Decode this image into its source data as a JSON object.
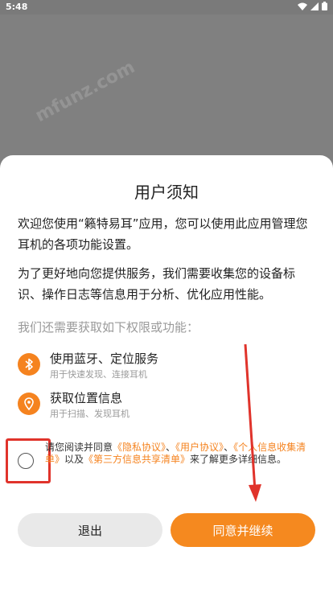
{
  "status_bar": {
    "time": "5:48"
  },
  "watermark": {
    "text": "mfunz.com"
  },
  "dialog": {
    "title": "用户须知",
    "paragraph1": "欢迎您使用“籁特易耳”应用，您可以使用此应用管理您耳机的各项功能设置。",
    "paragraph2": "为了更好地向您提供服务，我们需要收集您的设备标识、操作日志等信息用于分析、优化应用性能。",
    "permissions_intro": "我们还需要获取如下权限或功能：",
    "permissions": [
      {
        "title": "使用蓝牙、定位服务",
        "subtitle": "用于快速发现、连接耳机",
        "icon": "bluetooth-icon"
      },
      {
        "title": "获取位置信息",
        "subtitle": "用于扫描、发现耳机",
        "icon": "location-pin-icon"
      }
    ],
    "agreement": {
      "checked": false,
      "prefix": "请您阅读并同意",
      "privacy_link": "《隐私协议》",
      "sep1": "、",
      "user_link": "《用户协议》",
      "sep2": "、",
      "personal_info_link": "《个人信息收集清单》",
      "middle": "以及",
      "third_party_link": "《第三方信息共享清单》",
      "suffix": "来了解更多详细信息。"
    },
    "buttons": {
      "exit": "退出",
      "agree": "同意并继续"
    }
  },
  "colors": {
    "accent": "#f5831f",
    "annotation_red": "#e0332b",
    "overlay": "#808080"
  }
}
